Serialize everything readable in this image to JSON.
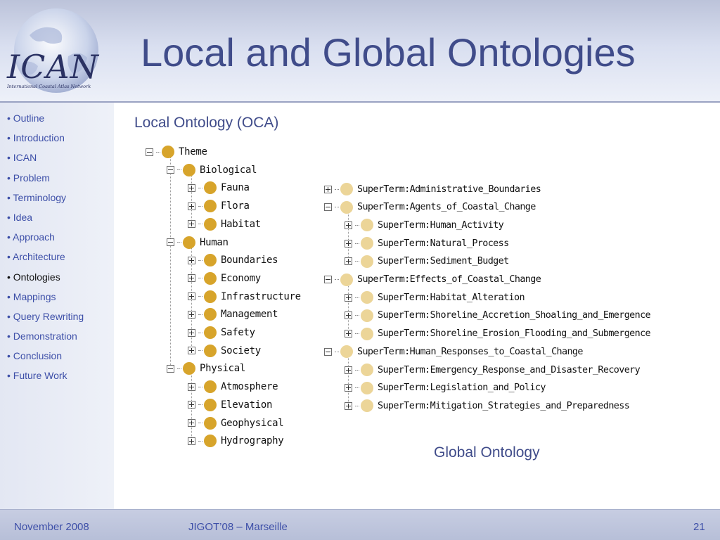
{
  "header": {
    "title": "Local and Global Ontologies",
    "logo_text": "ICAN",
    "logo_subtitle": "International Coastal Atlas Network"
  },
  "sidebar": {
    "items": [
      {
        "label": "• Outline",
        "active": false
      },
      {
        "label": "• Introduction",
        "active": false
      },
      {
        "label": "• ICAN",
        "active": false
      },
      {
        "label": "• Problem",
        "active": false
      },
      {
        "label": "• Terminology",
        "active": false
      },
      {
        "label": "• Idea",
        "active": false
      },
      {
        "label": "• Approach",
        "active": false
      },
      {
        "label": "• Architecture",
        "active": false
      },
      {
        "label": "• Ontologies",
        "active": true
      },
      {
        "label": "• Mappings",
        "active": false
      },
      {
        "label": "• Query Rewriting",
        "active": false
      },
      {
        "label": "• Demonstration",
        "active": false
      },
      {
        "label": "• Conclusion",
        "active": false
      },
      {
        "label": "• Future Work",
        "active": false
      }
    ]
  },
  "local_ontology": {
    "caption": "Local Ontology (OCA)",
    "nodes": [
      {
        "label": "Theme",
        "level": 0,
        "expanded": true
      },
      {
        "label": "Biological",
        "level": 1,
        "expanded": true
      },
      {
        "label": "Fauna",
        "level": 2,
        "expanded": false
      },
      {
        "label": "Flora",
        "level": 2,
        "expanded": false
      },
      {
        "label": "Habitat",
        "level": 2,
        "expanded": false
      },
      {
        "label": "Human",
        "level": 1,
        "expanded": true
      },
      {
        "label": "Boundaries",
        "level": 2,
        "expanded": false
      },
      {
        "label": "Economy",
        "level": 2,
        "expanded": false
      },
      {
        "label": "Infrastructure",
        "level": 2,
        "expanded": false
      },
      {
        "label": "Management",
        "level": 2,
        "expanded": false
      },
      {
        "label": "Safety",
        "level": 2,
        "expanded": false
      },
      {
        "label": "Society",
        "level": 2,
        "expanded": false
      },
      {
        "label": "Physical",
        "level": 1,
        "expanded": true
      },
      {
        "label": "Atmosphere",
        "level": 2,
        "expanded": false
      },
      {
        "label": "Elevation",
        "level": 2,
        "expanded": false
      },
      {
        "label": "Geophysical",
        "level": 2,
        "expanded": false
      },
      {
        "label": "Hydrography",
        "level": 2,
        "expanded": false
      }
    ]
  },
  "global_ontology": {
    "caption": "Global Ontology",
    "nodes": [
      {
        "label": "SuperTerm:Administrative_Boundaries",
        "level": 0,
        "expanded": false
      },
      {
        "label": "SuperTerm:Agents_of_Coastal_Change",
        "level": 0,
        "expanded": true
      },
      {
        "label": "SuperTerm:Human_Activity",
        "level": 1,
        "expanded": false
      },
      {
        "label": "SuperTerm:Natural_Process",
        "level": 1,
        "expanded": false
      },
      {
        "label": "SuperTerm:Sediment_Budget",
        "level": 1,
        "expanded": false
      },
      {
        "label": "SuperTerm:Effects_of_Coastal_Change",
        "level": 0,
        "expanded": true
      },
      {
        "label": "SuperTerm:Habitat_Alteration",
        "level": 1,
        "expanded": false
      },
      {
        "label": "SuperTerm:Shoreline_Accretion_Shoaling_and_Emergence",
        "level": 1,
        "expanded": false
      },
      {
        "label": "SuperTerm:Shoreline_Erosion_Flooding_and_Submergence",
        "level": 1,
        "expanded": false
      },
      {
        "label": "SuperTerm:Human_Responses_to_Coastal_Change",
        "level": 0,
        "expanded": true
      },
      {
        "label": "SuperTerm:Emergency_Response_and_Disaster_Recovery",
        "level": 1,
        "expanded": false
      },
      {
        "label": "SuperTerm:Legislation_and_Policy",
        "level": 1,
        "expanded": false
      },
      {
        "label": "SuperTerm:Mitigation_Strategies_and_Preparedness",
        "level": 1,
        "expanded": false
      }
    ]
  },
  "footer": {
    "date": "November 2008",
    "event": "JIGOT’08 – Marseille",
    "page_number": "21"
  },
  "colors": {
    "title": "#404c8a",
    "nav_link": "#3d4fa8",
    "local_node": "#d7a42b",
    "global_node": "#ecd598"
  }
}
